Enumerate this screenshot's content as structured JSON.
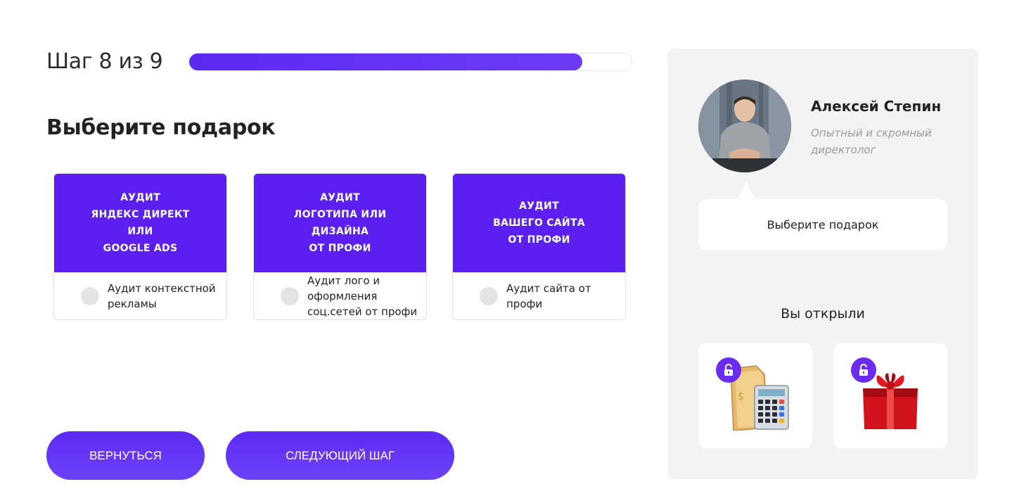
{
  "progress": {
    "step_label": "Шаг 8 из 9",
    "fraction": 0.888
  },
  "heading": "Выберите подарок",
  "options": [
    {
      "image_lines": [
        "Аудит",
        "Яндекс Директ",
        "или",
        "Google Ads"
      ],
      "caption_lines": [
        "Аудит контекстной",
        "рекламы"
      ],
      "selected": false
    },
    {
      "image_lines": [
        "Аудит",
        "логотипа или",
        "дизайна",
        "от профи"
      ],
      "caption_lines": [
        "Аудит лого и",
        "оформления",
        "соц.сетей от профи"
      ],
      "selected": false
    },
    {
      "image_lines": [
        "Аудит",
        "вашего сайта",
        "от профи"
      ],
      "caption_lines": [
        "Аудит сайта от",
        "профи"
      ],
      "selected": false
    }
  ],
  "buttons": {
    "back": "Вернуться",
    "next": "Следующий шаг"
  },
  "expert": {
    "name": "Алексей Степин",
    "description": "Опытный и скромный директолог",
    "message": "Выберите подарок"
  },
  "unlocked": {
    "label": "Вы открыли",
    "items": [
      {
        "icon": "folder-calculator-icon"
      },
      {
        "icon": "red-gift-box-icon"
      }
    ]
  },
  "colors": {
    "accent": "#5b20f0",
    "panel_bg": "#f3f3f3"
  }
}
